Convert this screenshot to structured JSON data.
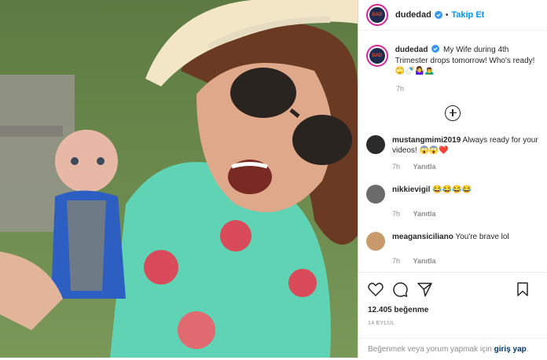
{
  "post": {
    "username": "dudedad",
    "follow_label": "Takip Et",
    "separator": "•",
    "avatar_text": "DAD"
  },
  "caption": {
    "username": "dudedad",
    "text": "My Wife during 4th Trimester drops tomorrow! Who's ready!",
    "emojis": "🙄🍼🤷‍♀️🙇‍♂️",
    "time": "7h"
  },
  "comments": [
    {
      "username": "mustangmimi2019",
      "text": "Always ready for your videos!",
      "emojis": "😱😱❤️",
      "time": "7h",
      "reply": "Yanıtla",
      "avatar_color": "#2b2b2b"
    },
    {
      "username": "nikkievigil",
      "text": "",
      "emojis": "😂😂😂😂",
      "time": "7h",
      "reply": "Yanıtla",
      "avatar_color": "#6b6b6b"
    },
    {
      "username": "meagansiciliano",
      "text": "You're brave lol",
      "emojis": "",
      "time": "7h",
      "reply": "Yanıtla",
      "avatar_color": "#c99a6b"
    }
  ],
  "likes": "12.405 beğenme",
  "date": "14 EYLÜL",
  "add_comment": {
    "prefix": "Beğenmek veya yorum yapmak için",
    "link": "giriş yap",
    "suffix": "."
  },
  "colors": {
    "accent": "#0095f6",
    "verified": "#3897f0",
    "ring": "#d6249f"
  },
  "icons": [
    "heart-icon",
    "comment-icon",
    "share-icon",
    "bookmark-icon",
    "add-comments-icon",
    "verified-badge-icon"
  ]
}
